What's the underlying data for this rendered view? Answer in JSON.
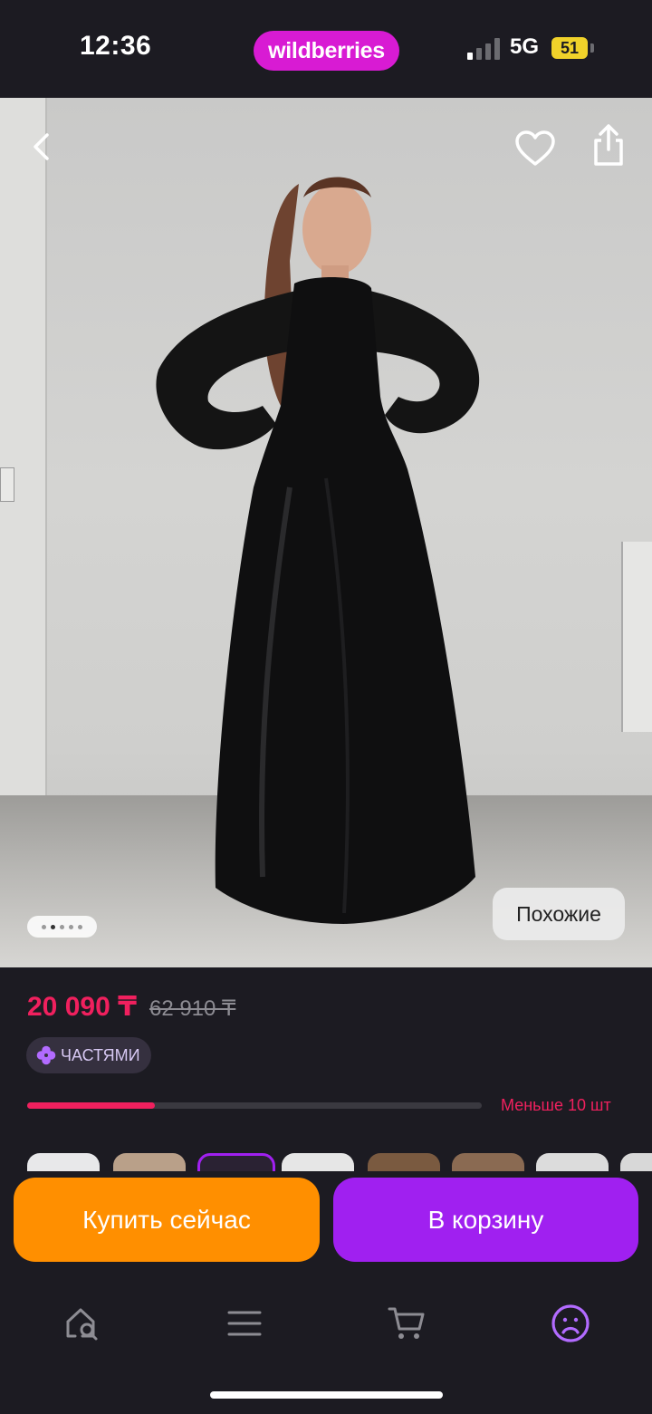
{
  "status_bar": {
    "time": "12:36",
    "brand": "wildberries",
    "network": "5G",
    "battery": "51"
  },
  "product": {
    "image_alt": "Black long-sleeve maxi dress",
    "gallery": {
      "total": 5,
      "active": 2
    },
    "similar_label": "Похожие",
    "price": "20 090 ₸",
    "old_price": "62 910 ₸",
    "installments_label": "ЧАСТЯМИ",
    "stock": {
      "label": "Меньше 10 шт",
      "level": 0.28
    }
  },
  "actions": {
    "buy_now": "Купить сейчас",
    "add_to_cart": "В корзину"
  },
  "tabbar": {
    "items": [
      "home-search",
      "menu",
      "cart",
      "profile"
    ],
    "active": "profile"
  },
  "colors": {
    "background": "#1c1b22",
    "brand": "#d81bd3",
    "price": "#f0205e",
    "buy_button": "#ff8f00",
    "cart_button": "#a020f0",
    "active_tab": "#b26bff"
  }
}
